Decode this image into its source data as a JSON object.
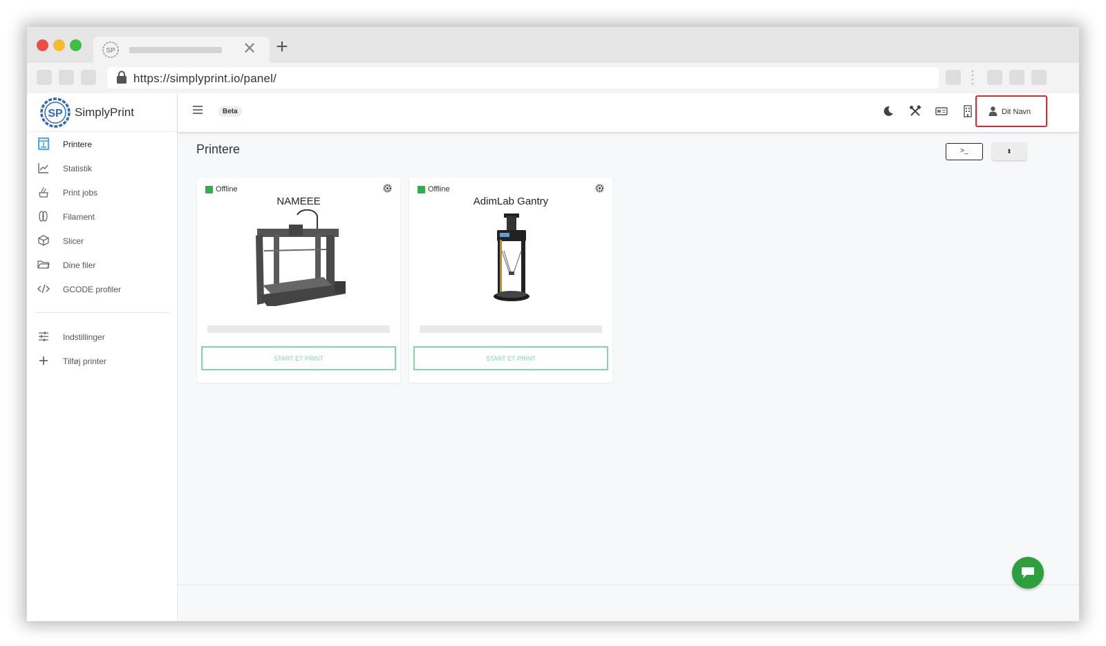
{
  "browser": {
    "url": "https://simplyprint.io/panel/",
    "tab_close_glyph": "✕",
    "new_tab_glyph": "+"
  },
  "app": {
    "brand_name": "SimplyPrint",
    "beta_label": "Beta",
    "user_name": "Dit Navn"
  },
  "sidebar": {
    "items": [
      {
        "label": "Printere",
        "icon": "printer-icon",
        "active": true
      },
      {
        "label": "Statistik",
        "icon": "chart-icon"
      },
      {
        "label": "Print jobs",
        "icon": "print-jobs-icon"
      },
      {
        "label": "Filament",
        "icon": "filament-icon"
      },
      {
        "label": "Slicer",
        "icon": "cube-icon"
      },
      {
        "label": "Dine filer",
        "icon": "folder-icon"
      },
      {
        "label": "GCODE profiler",
        "icon": "code-icon"
      }
    ],
    "secondary": [
      {
        "label": "Indstillinger",
        "icon": "sliders-icon"
      },
      {
        "label": "Tilføj printer",
        "icon": "plus-icon"
      }
    ]
  },
  "main": {
    "title": "Printere",
    "console_label": ">_",
    "sort_label": "⬍",
    "printers": [
      {
        "name": "NAMEEE",
        "status": "Offline",
        "button_label": "START ET PRINT"
      },
      {
        "name": "AdimLab Gantry",
        "status": "Offline",
        "button_label": "START ET PRINT"
      }
    ]
  },
  "colors": {
    "status_offline": "#2eaf4a",
    "accent_green": "#7fd8a0",
    "highlight_red": "#e02929",
    "chat_green": "#2e9f3e",
    "brand_blue": "#2a6ac4"
  }
}
